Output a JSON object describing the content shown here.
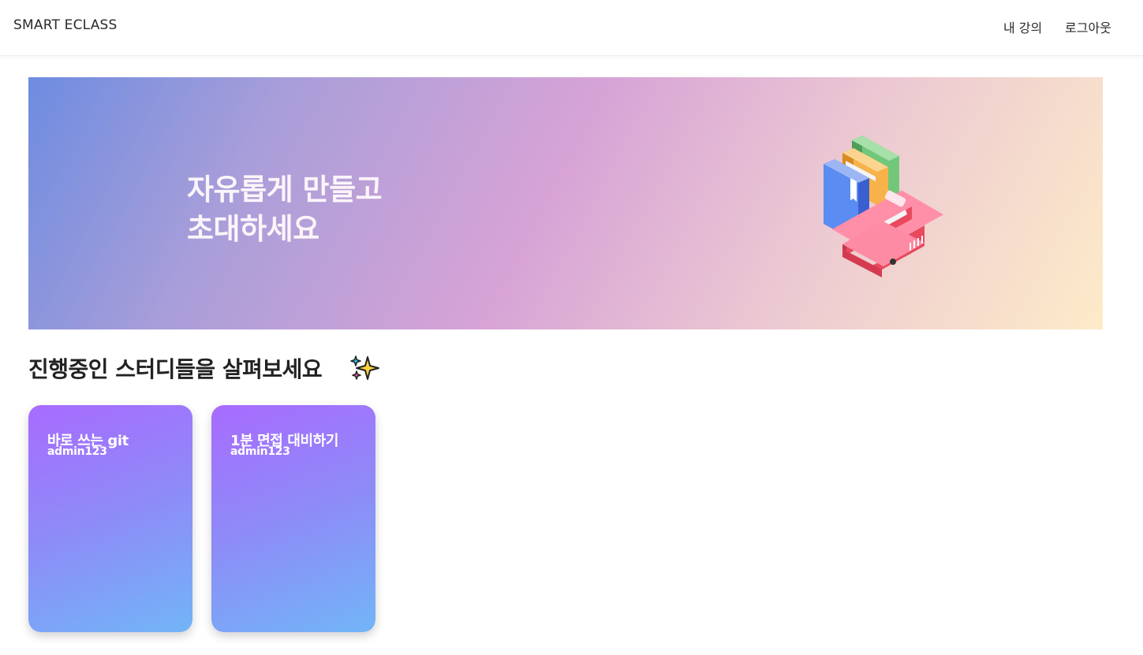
{
  "nav": {
    "brand": "SMART ECLASS",
    "my_courses": "내 강의",
    "logout": "로그아웃"
  },
  "hero": {
    "line1": "자유롭게 만들고",
    "line2": "초대하세요",
    "illustration_icon": "books-icon"
  },
  "section": {
    "title": "진행중인 스터디들을 살펴보세요",
    "icon": "sparkle-icon"
  },
  "studies": [
    {
      "title": "바로 쓰는 git",
      "author": "admin123"
    },
    {
      "title": "1분 면접 대비하기",
      "author": "admin123"
    }
  ],
  "colors": {
    "card_gradient_start": "#a86bff",
    "card_gradient_end": "#72b5f7",
    "hero_gradient_start": "#6e8ce0",
    "hero_gradient_mid": "#d7a3d6",
    "hero_gradient_end": "#fdebc8"
  }
}
